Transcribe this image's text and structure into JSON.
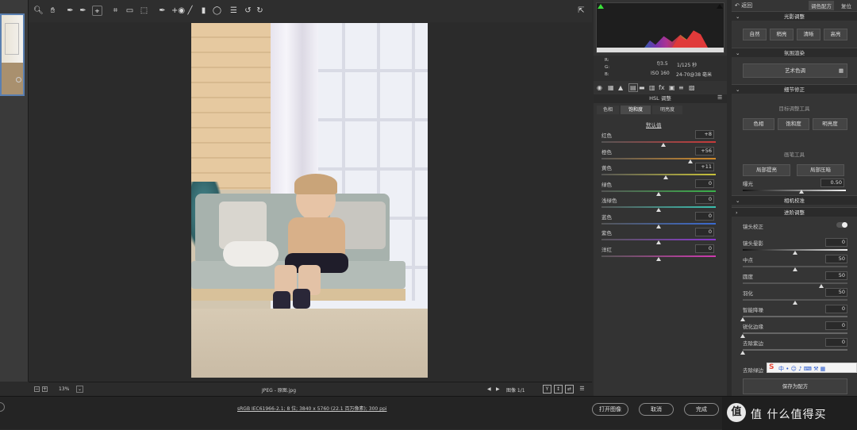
{
  "toolbar": {
    "tools": [
      "zoom-icon",
      "hand-icon",
      "white-balance-icon",
      "color-sampler-icon",
      "target-adjust-icon",
      "crop-icon",
      "straighten-icon",
      "transform-icon",
      "spot-removal-icon",
      "red-eye-icon",
      "brush-icon",
      "graduated-filter-icon",
      "radial-filter-icon",
      "preferences-icon",
      "rotate-ccw-icon",
      "rotate-cw-icon"
    ]
  },
  "status": {
    "zoom": "13%",
    "filename": "JPEG - 原图.jpg",
    "image_count": "图像 1/1"
  },
  "bottom": {
    "info": "sRGB IEC61966-2.1; 8 位; 3840 x 5760 (22.1 百万像素); 300 ppi",
    "open_label": "打开图像",
    "cancel_label": "取消",
    "done_label": "完成",
    "watermark": "值 什么值得买"
  },
  "camera": {
    "r": "R:",
    "g": "G:",
    "b": "B:",
    "aperture": "f/3.5",
    "shutter": "1/125 秒",
    "iso": "ISO 160",
    "lens": "24-70@38 毫米"
  },
  "hsl": {
    "title": "HSL 调整",
    "tabs": [
      "色相",
      "饱和度",
      "明亮度"
    ],
    "default_link": "默认值",
    "rows": [
      {
        "label": "红色",
        "value": "+8",
        "pos": 0.54,
        "color": "#c83a3a"
      },
      {
        "label": "橙色",
        "value": "+56",
        "pos": 0.78,
        "color": "#d08a2a"
      },
      {
        "label": "黄色",
        "value": "+11",
        "pos": 0.56,
        "color": "#c8c23a"
      },
      {
        "label": "绿色",
        "value": "0",
        "pos": 0.5,
        "color": "#3ab24a"
      },
      {
        "label": "浅绿色",
        "value": "0",
        "pos": 0.5,
        "color": "#3ac0b0"
      },
      {
        "label": "蓝色",
        "value": "0",
        "pos": 0.5,
        "color": "#3a6ad0"
      },
      {
        "label": "紫色",
        "value": "0",
        "pos": 0.5,
        "color": "#8a3ad0"
      },
      {
        "label": "洋红",
        "value": "0",
        "pos": 0.5,
        "color": "#d03ab0"
      }
    ]
  },
  "right": {
    "back_label": "返回",
    "tab_active": "调色配方",
    "tab_reset": "复位",
    "light_title": "光影调整",
    "light_buttons": [
      "自然",
      "稍亮",
      "清晰",
      "高亮"
    ],
    "atmosphere_title": "氛围渲染",
    "art_button": "艺术色调",
    "detail_title": "细节修正",
    "target_tool_label": "目标调整工具",
    "target_buttons": [
      "色相",
      "饱和度",
      "明亮度"
    ],
    "brush_tool_label": "画笔工具",
    "brush_buttons": [
      "局部提亮",
      "局部压暗"
    ],
    "exposure_label": "曝光",
    "exposure_value": "0.50",
    "camera_cal": "相机校准",
    "advanced": "进阶调整",
    "lens_label": "镜头校正",
    "vignette_rows": [
      {
        "label": "镜头晕影",
        "value": "0",
        "pos": 0.5
      },
      {
        "label": "中点",
        "value": "50",
        "pos": 0.5
      },
      {
        "label": "圆度",
        "value": "50",
        "pos": 0.75
      },
      {
        "label": "羽化",
        "value": "50",
        "pos": 0.5
      },
      {
        "label": "智能降噪",
        "value": "0",
        "pos": 0.0
      },
      {
        "label": "锐化边缘",
        "value": "0",
        "pos": 0.0
      },
      {
        "label": "去除紫边",
        "value": "0",
        "pos": 0.0
      }
    ],
    "last_label": "去除绿边",
    "save_button": "保存为配方"
  },
  "colors": {
    "accent": "#5a7fb0",
    "panel": "#333333"
  }
}
